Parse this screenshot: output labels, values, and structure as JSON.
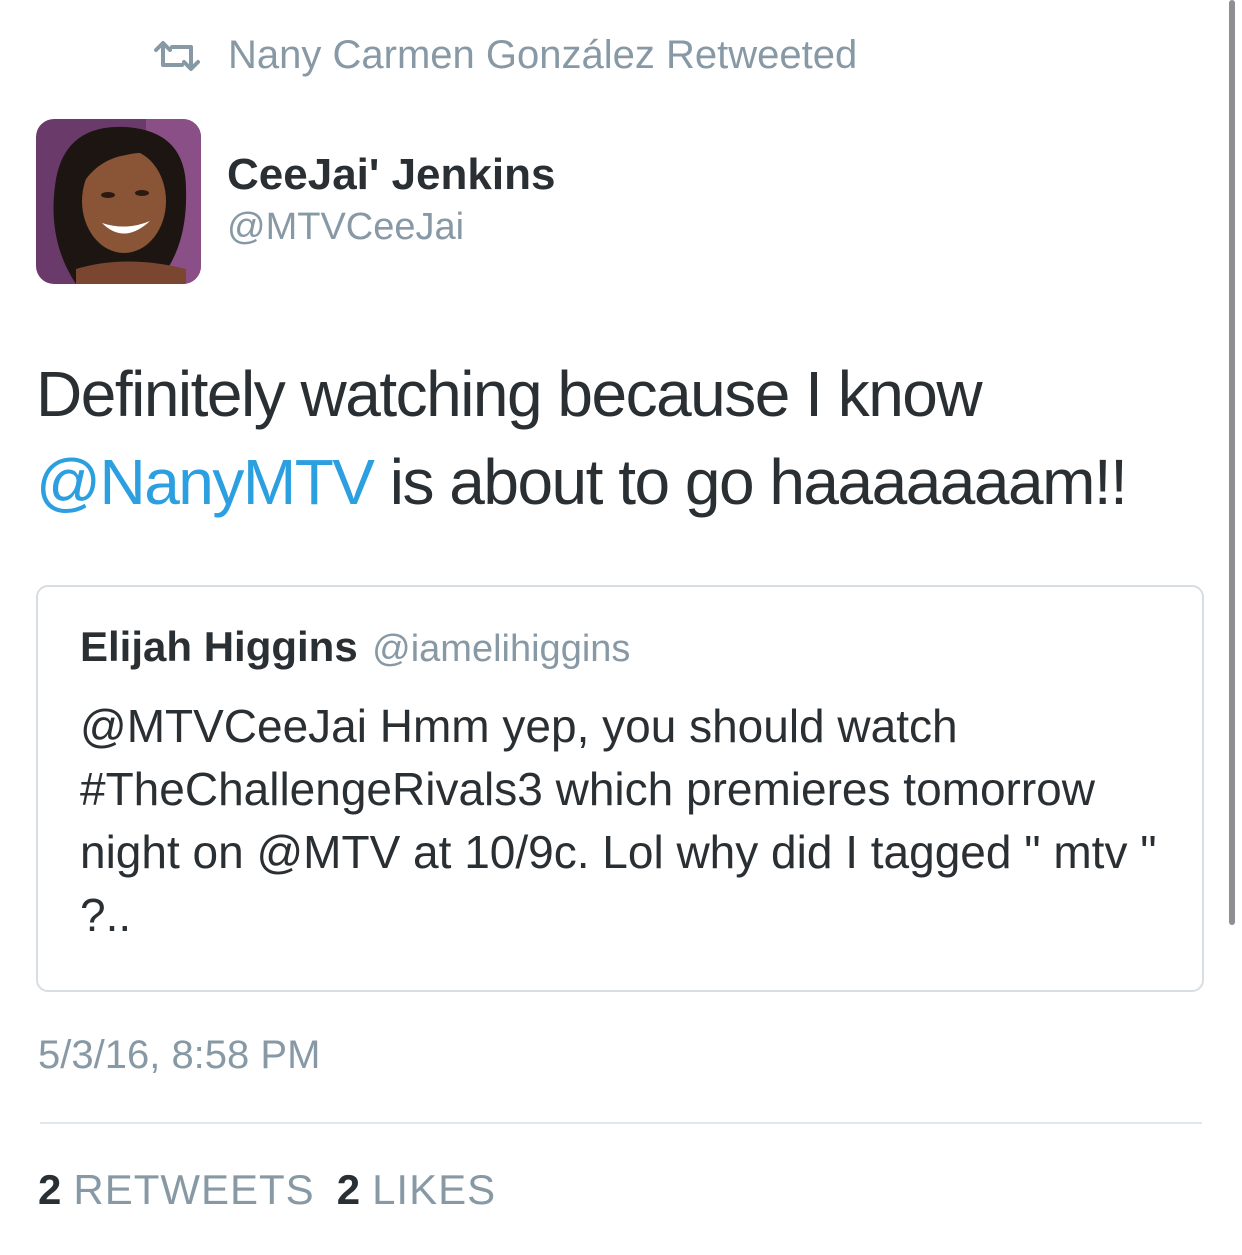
{
  "retweet": {
    "icon": "retweet-icon",
    "text": "Nany Carmen González Retweeted"
  },
  "tweet": {
    "author_name": "CeeJai' Jenkins",
    "author_handle": "@MTVCeeJai",
    "avatar": "profile-photo",
    "text_part1": "Definitely watching because I know",
    "mention": "@NanyMTV",
    "text_part2": " is about to go haaaaaaam!!",
    "timestamp": "5/3/16, 8:58 PM"
  },
  "quoted": {
    "name": "Elijah Higgins",
    "handle": "@iamelihiggins",
    "text": "@MTVCeeJai Hmm yep, you should watch #TheChallengeRivals3 which premieres tomorrow night on @MTV at 10/9c. Lol why did I tagged \" mtv \" ?.."
  },
  "stats": {
    "retweets_count": "2",
    "retweets_label": "RETWEETS",
    "likes_count": "2",
    "likes_label": "LIKES"
  },
  "colors": {
    "accent": "#2b9fe0",
    "secondary_text": "#8899a6",
    "primary_text": "#292f33"
  }
}
